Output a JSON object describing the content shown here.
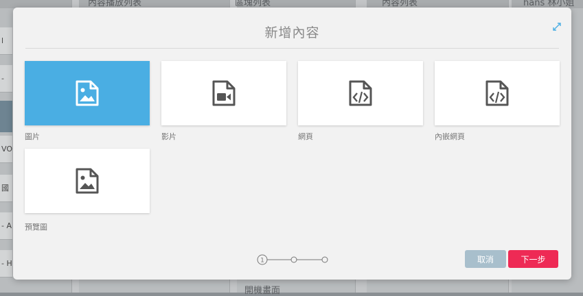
{
  "background": {
    "top_labels": [
      "內容播放列表",
      "區塊列表",
      "內容列表",
      "hans 林小姐"
    ],
    "bottom_label": "開機畫面",
    "left_snippets": [
      "l",
      "-",
      "VO",
      "國家",
      "- A",
      "- H"
    ]
  },
  "modal": {
    "title": "新增內容",
    "content_types": [
      {
        "label": "圖片",
        "icon": "image-file-icon",
        "selected": true
      },
      {
        "label": "影片",
        "icon": "video-file-icon",
        "selected": false
      },
      {
        "label": "網頁",
        "icon": "code-file-icon",
        "selected": false
      },
      {
        "label": "內嵌網頁",
        "icon": "code-file-icon",
        "selected": false
      },
      {
        "label": "預覽圖",
        "icon": "image-file-icon",
        "selected": false
      }
    ],
    "stepper": {
      "current_label": "1",
      "total_steps": 3,
      "current_step": 1
    },
    "buttons": {
      "cancel": "取消",
      "next": "下一步"
    }
  },
  "colors": {
    "selected_card": "#4aaee3",
    "next_button": "#ee2a55",
    "cancel_button": "#a8bfcc",
    "icon_dark": "#555555"
  }
}
